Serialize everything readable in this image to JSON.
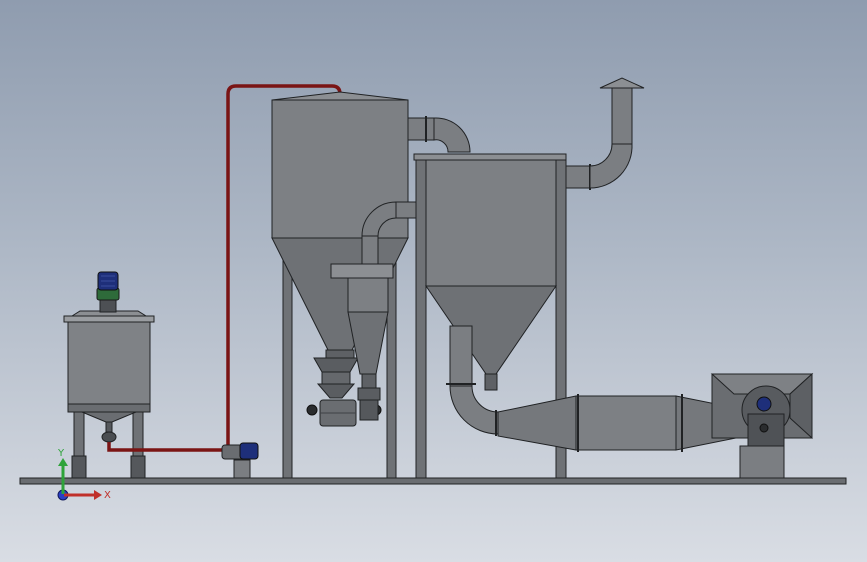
{
  "view": {
    "background_top": "#8f9caf",
    "background_bottom": "#d9dde4"
  },
  "triad": {
    "x_label": "X",
    "y_label": "Y",
    "x_color": "#c0302a",
    "y_color": "#2ea33a",
    "z_color": "#2a3fc4"
  },
  "colors": {
    "equipment_fill": "#7b7e82",
    "equipment_dark": "#55585c",
    "equipment_light": "#9a9da1",
    "outline": "#202224",
    "slurry_pipe": "#7a1414",
    "motor_blue": "#1e2f7a",
    "motor_green": "#2e6b3a"
  },
  "equipment": [
    {
      "id": "mixing-tank",
      "icon": "agitated-tank-icon"
    },
    {
      "id": "feed-pump",
      "icon": "pump-icon"
    },
    {
      "id": "drying-tower",
      "icon": "spray-dryer-icon"
    },
    {
      "id": "cyclone-separator",
      "icon": "cyclone-icon"
    },
    {
      "id": "bag-filter",
      "icon": "bag-filter-icon"
    },
    {
      "id": "induced-draft-fan",
      "icon": "fan-icon"
    },
    {
      "id": "exhaust-stack",
      "icon": "stack-icon"
    }
  ]
}
